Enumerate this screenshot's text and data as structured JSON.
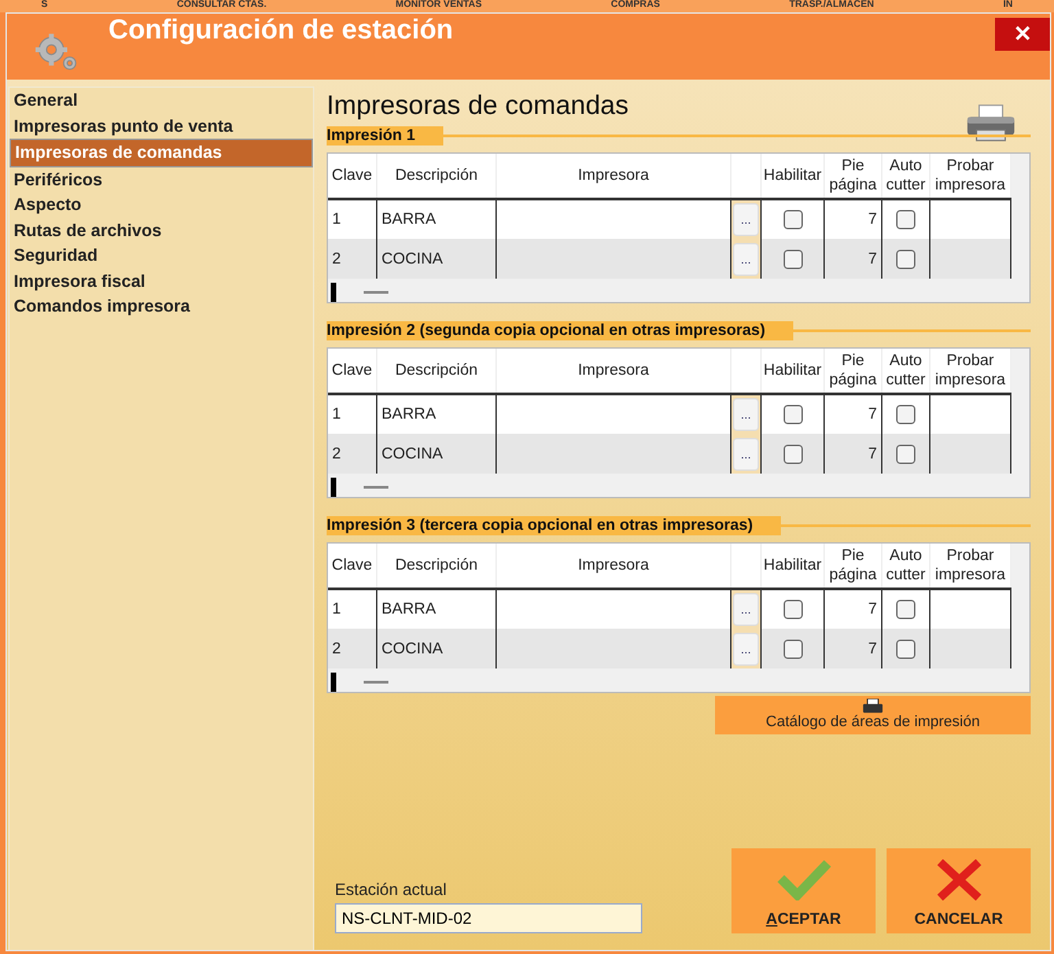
{
  "background_menu": [
    "S",
    "CONSULTAR CTAS.",
    "MONITOR VENTAS",
    "COMPRAS",
    "TRASP./ALMACEN",
    "IN"
  ],
  "window": {
    "title": "Configuración de estación",
    "close": "✕"
  },
  "sidebar": {
    "items": [
      {
        "label": "General",
        "selected": false
      },
      {
        "label": "Impresoras punto de venta",
        "selected": false
      },
      {
        "label": "Impresoras de comandas",
        "selected": true
      },
      {
        "label": "Periféricos",
        "selected": false
      },
      {
        "label": "Aspecto",
        "selected": false
      },
      {
        "label": "Rutas de archivos",
        "selected": false
      },
      {
        "label": "Seguridad",
        "selected": false
      },
      {
        "label": "Impresora fiscal",
        "selected": false
      },
      {
        "label": "Comandos impresora",
        "selected": false
      }
    ]
  },
  "page_title": "Impresoras de comandas",
  "sections": [
    {
      "title": "Impresión 1",
      "columns": [
        "Clave",
        "Descripción",
        "Impresora",
        "",
        "Habilitar",
        "Pie página",
        "Auto cutter",
        "Probar impresora"
      ],
      "rows": [
        {
          "clave": "1",
          "descripcion": "BARRA",
          "browse": "...",
          "habilitar": false,
          "pie": "7",
          "cutter": false
        },
        {
          "clave": "2",
          "descripcion": "COCINA",
          "browse": "...",
          "habilitar": false,
          "pie": "7",
          "cutter": false
        }
      ]
    },
    {
      "title": "Impresión 2 (segunda copia opcional en otras impresoras)",
      "columns": [
        "Clave",
        "Descripción",
        "Impresora",
        "",
        "Habilitar",
        "Pie página",
        "Auto cutter",
        "Probar impresora"
      ],
      "rows": [
        {
          "clave": "1",
          "descripcion": "BARRA",
          "browse": "...",
          "habilitar": false,
          "pie": "7",
          "cutter": false
        },
        {
          "clave": "2",
          "descripcion": "COCINA",
          "browse": "...",
          "habilitar": false,
          "pie": "7",
          "cutter": false
        }
      ]
    },
    {
      "title": "Impresión 3 (tercera copia opcional en otras impresoras)",
      "columns": [
        "Clave",
        "Descripción",
        "Impresora",
        "",
        "Habilitar",
        "Pie página",
        "Auto cutter",
        "Probar impresora"
      ],
      "rows": [
        {
          "clave": "1",
          "descripcion": "BARRA",
          "browse": "...",
          "habilitar": false,
          "pie": "7",
          "cutter": false
        },
        {
          "clave": "2",
          "descripcion": "COCINA",
          "browse": "...",
          "habilitar": false,
          "pie": "7",
          "cutter": false
        }
      ]
    }
  ],
  "catalog_button": "Catálogo de áreas de impresión",
  "station": {
    "label": "Estación actual",
    "value": "NS-CLNT-MID-02"
  },
  "buttons": [
    {
      "kind": "accept",
      "label": "ACEPTAR"
    },
    {
      "kind": "cancel",
      "label": "CANCELAR"
    }
  ]
}
